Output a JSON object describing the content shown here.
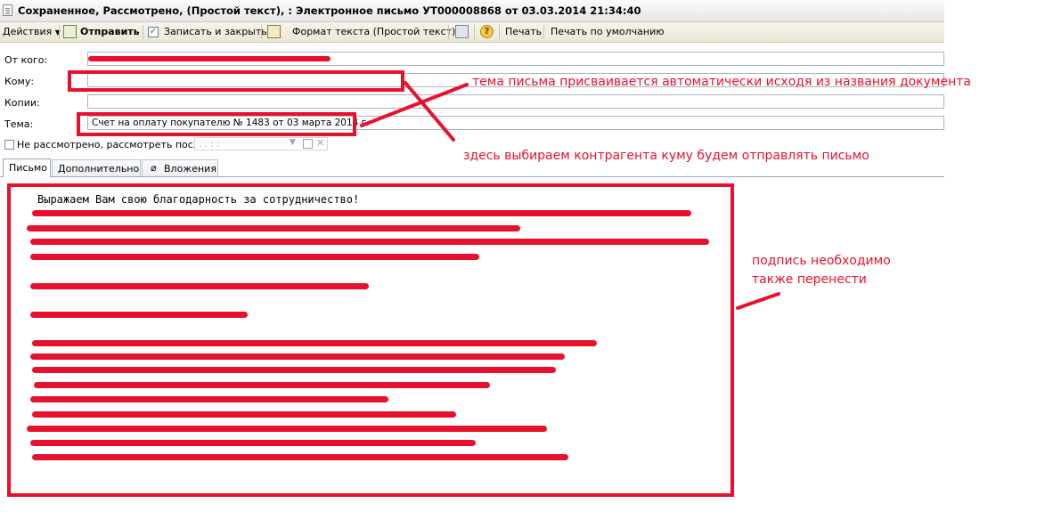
{
  "window": {
    "title": "Сохраненное, Рассмотрено,  (Простой текст), : Электронное письмо УТ000008868 от 03.03.2014 21:34:40"
  },
  "toolbar": {
    "actions_label": "Действия",
    "send_label": "Отправить",
    "save_close_label": "Записать и закрыть",
    "text_format_label": "Формат текста (Простой текст)",
    "print_label": "Печать",
    "print_default_label": "Печать по умолчанию"
  },
  "form": {
    "from_label": "От кого:",
    "to_label": "Кому:",
    "cc_label": "Копии:",
    "subject_label": "Тема:",
    "subject_value": "Счет на оплату покупателю № 1483 от 03 марта 2014 г.",
    "not_reviewed_label": "Не рассмотрено, рассмотреть после:",
    "review_date_placeholder": ". .   : :"
  },
  "tabs": [
    {
      "label": "Письмо",
      "active": true
    },
    {
      "label": "Дополнительно",
      "active": false
    },
    {
      "label": "Вложения",
      "active": false
    }
  ],
  "body": {
    "first_line": "Выражаем Вам свою благодарность за сотрудничество!"
  },
  "annotations": {
    "subject_note": "тема письма присваивается автоматически исходя из названия документа",
    "recipient_note": "здесь выбираем контрагента куму будем отправлять письмо",
    "signature_note_line1": "подпись необходимо",
    "signature_note_line2": "также перенести",
    "annotation_color": "#e8112d"
  }
}
